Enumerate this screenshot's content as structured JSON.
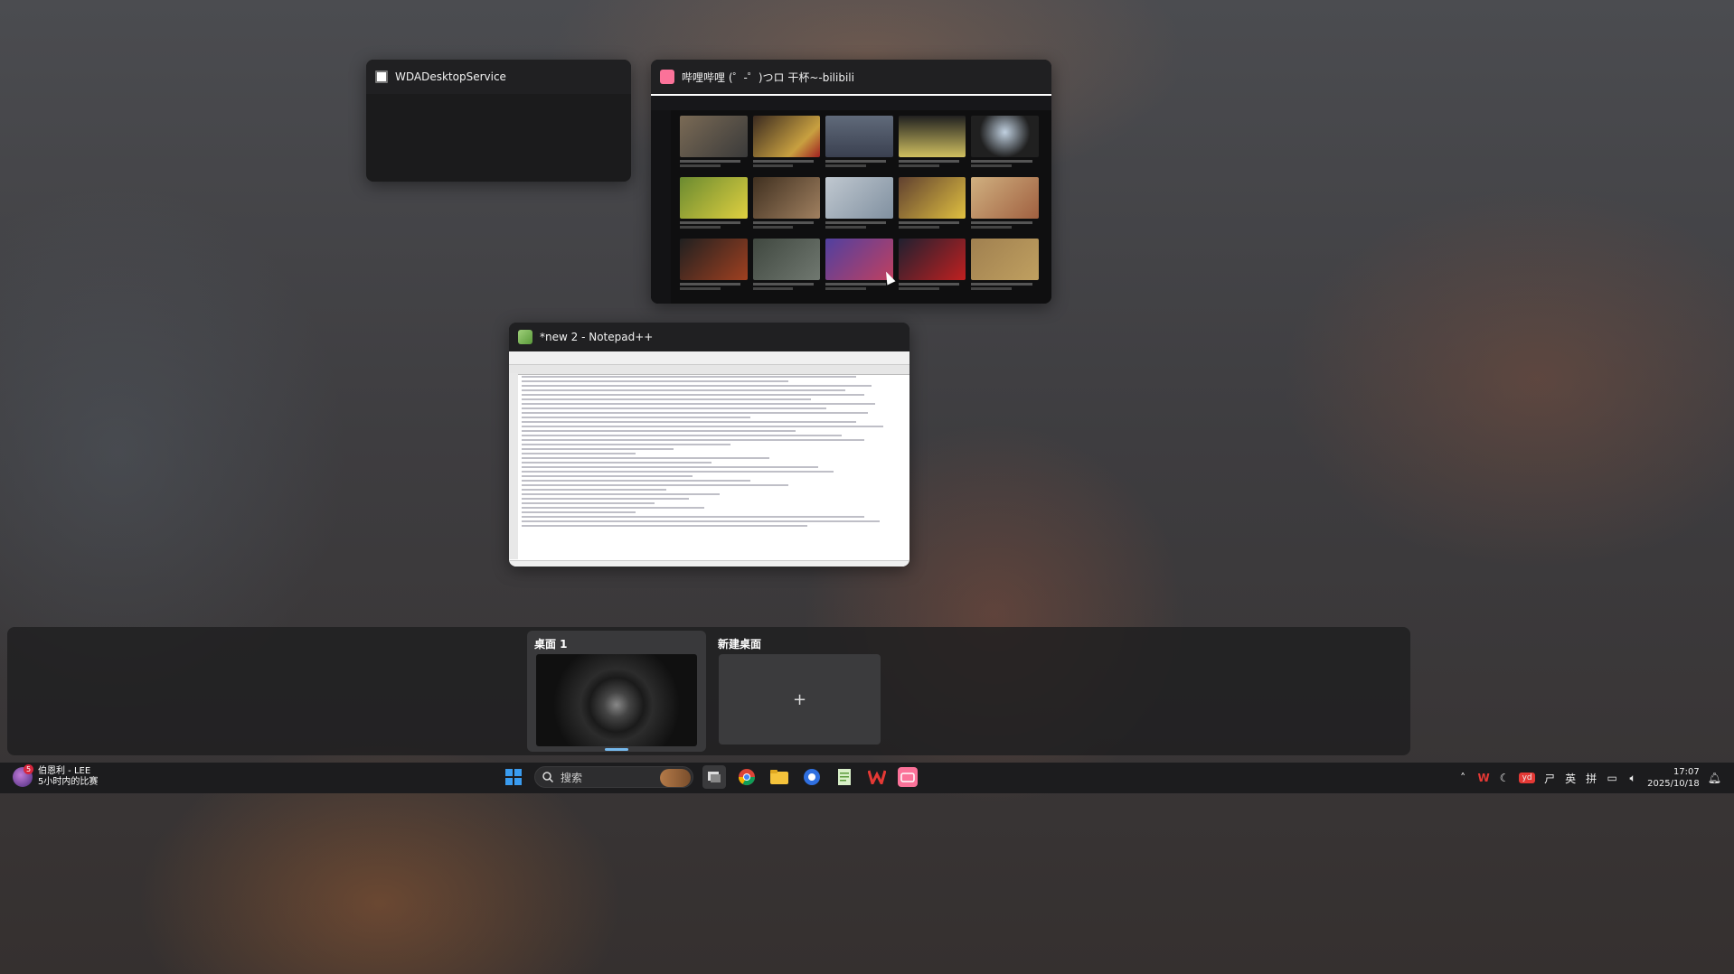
{
  "windows": [
    {
      "title": "WDADesktopService",
      "icon": "generic-window-icon"
    },
    {
      "title": "哔哩哔哩 (゜-゜)つロ 干杯~-bilibili",
      "icon": "bilibili-icon"
    },
    {
      "title": "*new 2 - Notepad++",
      "icon": "notepad-plus-plus-icon"
    }
  ],
  "desktops": [
    {
      "label": "桌面 1",
      "active": true
    },
    {
      "label": "新建桌面",
      "action": "+"
    }
  ],
  "taskbar": {
    "news": {
      "title": "伯恩利 - LEE",
      "subtitle": "5小时内的比赛",
      "badge": "5"
    },
    "search_placeholder": "搜索",
    "apps": [
      "start-icon",
      "search-icon",
      "task-view-icon",
      "chrome-icon",
      "file-explorer-icon",
      "browser-icon",
      "notepad-plus-plus-icon",
      "wps-icon",
      "bilibili-icon"
    ],
    "tray": {
      "ime_lang": "英",
      "ime_mode": "拼",
      "time": "17:07",
      "date": "2025/10/18"
    }
  },
  "colors": {
    "accent": "#76b9ed",
    "bilibili": "#fb7299",
    "wps": "#e53935"
  }
}
